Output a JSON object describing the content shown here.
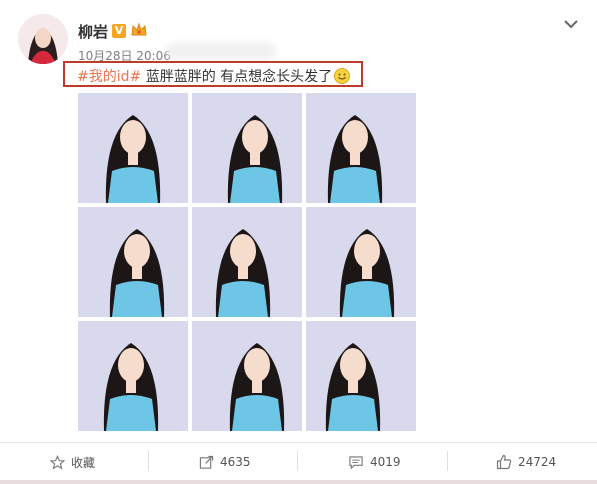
{
  "post": {
    "author": "柳岩",
    "verified_badge": "V",
    "timestamp": "10月28日 20:06",
    "hashtag": "#我的id#",
    "text": " 蓝胖蓝胖的 有点想念长头发了"
  },
  "photos": [
    {
      "label": "photo-1"
    },
    {
      "label": "photo-2"
    },
    {
      "label": "photo-3"
    },
    {
      "label": "photo-4"
    },
    {
      "label": "photo-5"
    },
    {
      "label": "photo-6"
    },
    {
      "label": "photo-7"
    },
    {
      "label": "photo-8"
    },
    {
      "label": "photo-9"
    }
  ],
  "actions": {
    "favorite_label": "收藏",
    "repost_count": "4635",
    "comment_count": "4019",
    "like_count": "24724"
  },
  "colors": {
    "hashtag": "#eb7350",
    "highlight_border": "#c0392b",
    "dress": "#6ec6e6",
    "photo_bg": "#d9d9ed"
  }
}
